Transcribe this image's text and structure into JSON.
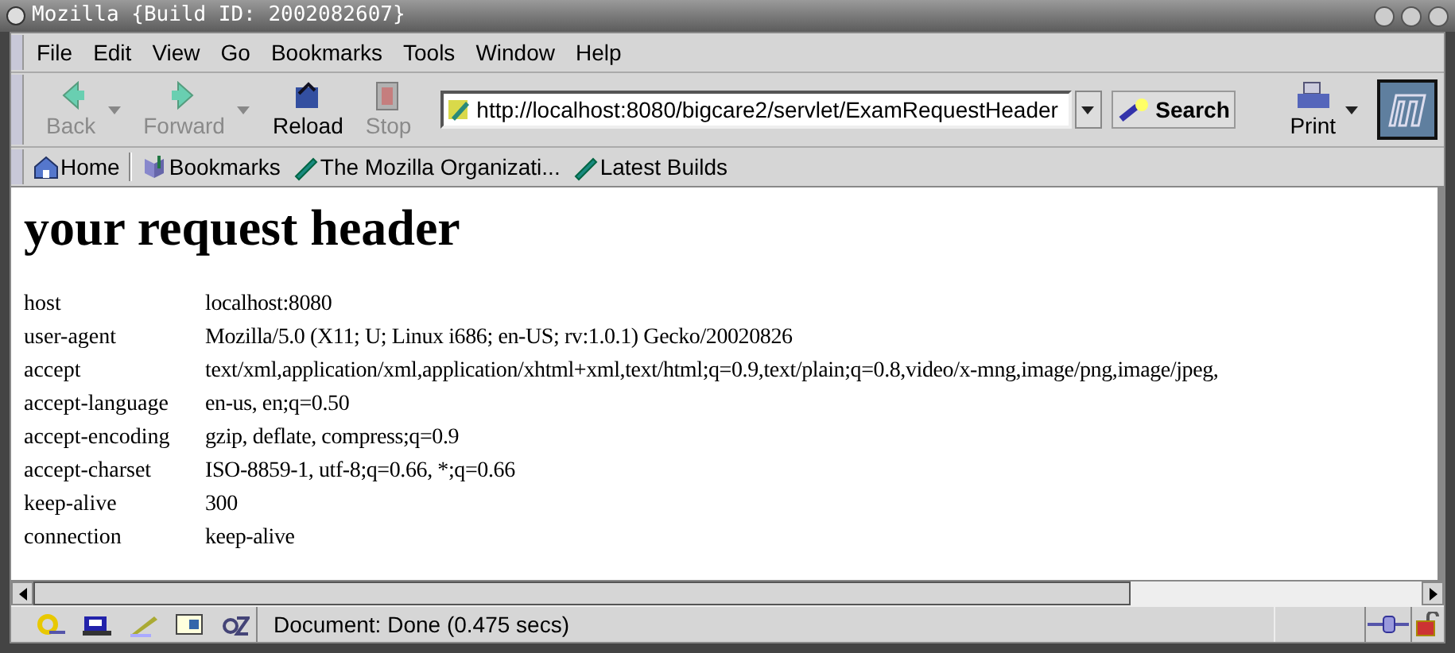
{
  "window": {
    "title": "Mozilla {Build ID: 2002082607}"
  },
  "menu": [
    "File",
    "Edit",
    "View",
    "Go",
    "Bookmarks",
    "Tools",
    "Window",
    "Help"
  ],
  "toolbar": [
    {
      "kind": "back",
      "label": "Back",
      "disabled": true,
      "dropdown": true
    },
    {
      "kind": "forward",
      "label": "Forward",
      "disabled": true,
      "dropdown": true
    },
    {
      "kind": "reload",
      "label": "Reload",
      "disabled": false,
      "dropdown": false
    },
    {
      "kind": "stop",
      "label": "Stop",
      "disabled": true,
      "dropdown": false
    }
  ],
  "address": {
    "value": "http://localhost:8080/bigcare2/servlet/ExamRequestHeader"
  },
  "search_button": "Search",
  "print_button": "Print",
  "personal_toolbar": [
    {
      "kind": "home",
      "label": "Home"
    },
    {
      "kind": "bookmarks",
      "label": "Bookmarks"
    },
    {
      "kind": "link",
      "label": "The Mozilla Organizati..."
    },
    {
      "kind": "link",
      "label": "Latest Builds"
    }
  ],
  "page": {
    "heading": "your request header",
    "rows": [
      {
        "name": "host",
        "value": "localhost:8080"
      },
      {
        "name": "user-agent",
        "value": "Mozilla/5.0 (X11; U; Linux i686; en-US; rv:1.0.1) Gecko/20020826"
      },
      {
        "name": "accept",
        "value": "text/xml,application/xml,application/xhtml+xml,text/html;q=0.9,text/plain;q=0.8,video/x-mng,image/png,image/jpeg,"
      },
      {
        "name": "accept-language",
        "value": "en-us, en;q=0.50"
      },
      {
        "name": "accept-encoding",
        "value": "gzip, deflate, compress;q=0.9"
      },
      {
        "name": "accept-charset",
        "value": "ISO-8859-1, utf-8;q=0.66, *;q=0.66"
      },
      {
        "name": "keep-alive",
        "value": "300"
      },
      {
        "name": "connection",
        "value": "keep-alive"
      }
    ]
  },
  "status_bar": {
    "text": "Document: Done (0.475 secs)"
  }
}
